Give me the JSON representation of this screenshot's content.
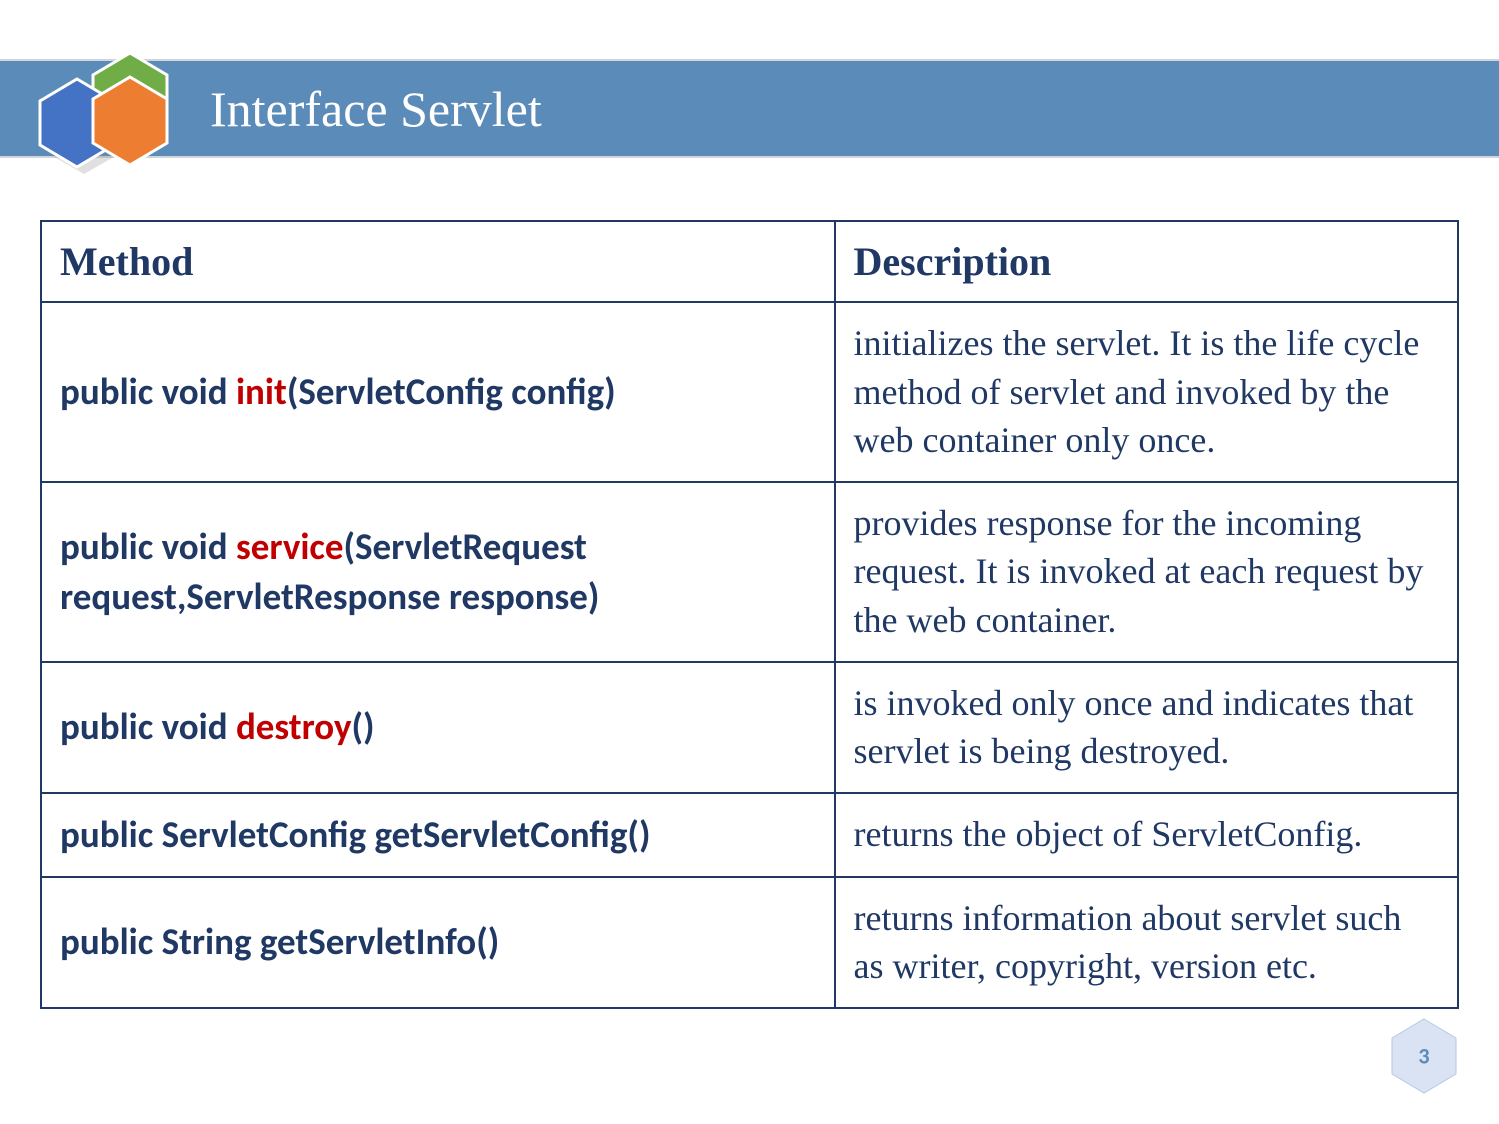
{
  "header": {
    "title": "Interface Servlet"
  },
  "table": {
    "headers": {
      "method": "Method",
      "description": "Description"
    },
    "rows": [
      {
        "sig_pre": "public void ",
        "sig_kw": "init",
        "sig_post": "(ServletConfig config)",
        "desc": "initializes the servlet. It is the life cycle method of servlet and invoked by the web container only once."
      },
      {
        "sig_pre": "public void ",
        "sig_kw": "service",
        "sig_post": "(ServletRequest request,ServletResponse response)",
        "desc": "provides response for the incoming request. It is invoked at each request by the web container."
      },
      {
        "sig_pre": "public void ",
        "sig_kw": "destroy",
        "sig_post": "()",
        "desc": "is invoked only once and indicates that servlet is being destroyed."
      },
      {
        "sig_pre": "public ServletConfig getServletConfig()",
        "sig_kw": "",
        "sig_post": "",
        "desc": "returns the object of ServletConfig."
      },
      {
        "sig_pre": "public String getServletInfo()",
        "sig_kw": "",
        "sig_post": "",
        "desc": "returns information about servlet such as writer, copyright, version etc."
      }
    ]
  },
  "page_number": "3",
  "colors": {
    "header_bg": "#5B8BB8",
    "border": "#203864",
    "text_dark": "#203864",
    "keyword": "#C00000",
    "hex_green": "#70AD47",
    "hex_blue": "#4472C4",
    "hex_orange": "#ED7D31",
    "pagenum_hex": "#B4C7E7"
  }
}
